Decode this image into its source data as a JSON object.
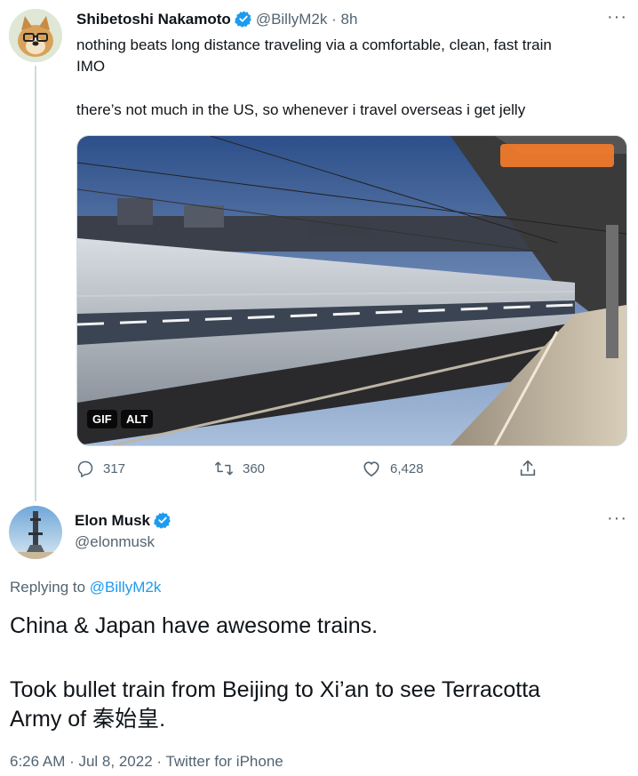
{
  "original_tweet": {
    "display_name": "Shibetoshi Nakamoto",
    "handle": "@BillyM2k",
    "time_sep": "·",
    "time": "8h",
    "text_line1": "nothing beats long distance traveling via a comfortable, clean, fast train",
    "text_line2": "IMO",
    "text_line3": "there’s not much in the US, so whenever i travel overseas i get jelly",
    "media_badges": {
      "gif": "GIF",
      "alt": "ALT"
    },
    "actions": {
      "replies": "317",
      "retweets": "360",
      "likes": "6,428"
    },
    "more_label": "···"
  },
  "reply_tweet": {
    "display_name": "Elon Musk",
    "handle": "@elonmusk",
    "replying_prefix": "Replying to",
    "replying_handle": "@BillyM2k",
    "text_line1": "China & Japan have awesome trains.",
    "text_line2": "Took bullet train from Beijing to Xi’an to see Terracotta",
    "text_line3": "Army of 秦始皇.",
    "timestamp": "6:26 AM · Jul 8, 2022 · Twitter for iPhone",
    "more_label": "···"
  },
  "colors": {
    "accent": "#1d9bf0",
    "muted": "#536471",
    "text": "#0f1419",
    "line": "#cfd9de"
  },
  "icons": [
    "verified-badge-icon",
    "reply-icon",
    "retweet-icon",
    "like-icon",
    "share-icon",
    "more-icon"
  ]
}
